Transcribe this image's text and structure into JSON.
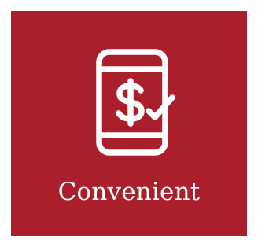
{
  "tile": {
    "label": "Convenient",
    "background_color": "#ab1f2c",
    "foreground_color": "#ffffff",
    "icon": "mobile-payment-check-icon"
  }
}
